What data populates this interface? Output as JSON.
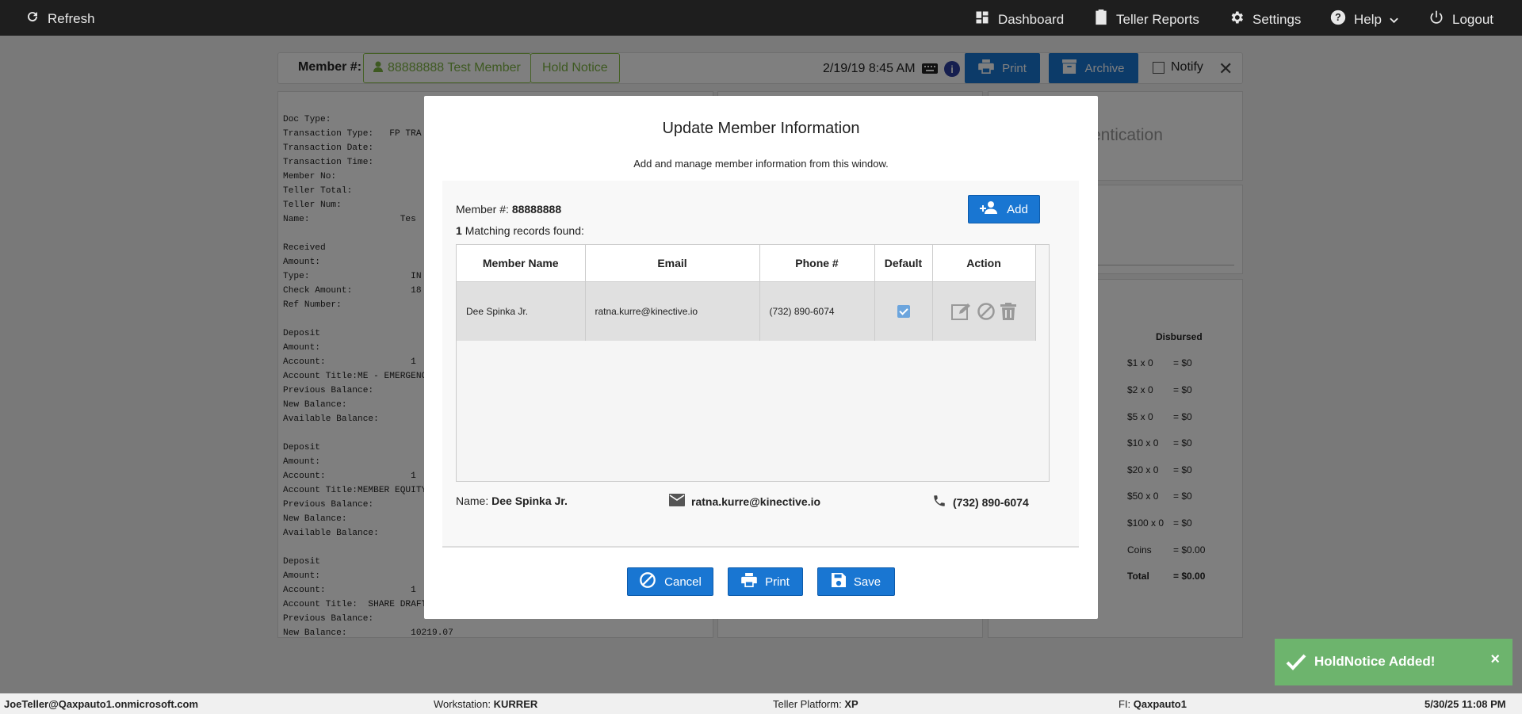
{
  "topbar": {
    "refresh": "Refresh",
    "dashboard": "Dashboard",
    "teller_reports": "Teller Reports",
    "settings": "Settings",
    "help": "Help",
    "logout": "Logout"
  },
  "member_bar": {
    "label": "Member #:",
    "member_chip": "88888888 Test Member",
    "hold_notice": "Hold Notice",
    "datetime": "2/19/19 8:45 AM",
    "info_icon": "i",
    "print": "Print",
    "archive": "Archive",
    "notify": "Notify",
    "close": "✕"
  },
  "receipt": {
    "text": "Doc Type:\nTransaction Type:   FP TRA\nTransaction Date:\nTransaction Time:\nMember No:\nTeller Total:\nTeller Num:\nName:                 Tes\n\nReceived\nAmount:\nType:                   IN\nCheck Amount:           18\nRef Number:\n\nDeposit\nAmount:\nAccount:                1\nAccount Title:ME - EMERGENC\nPrevious Balance:\nNew Balance:\nAvailable Balance:\n\nDeposit\nAmount:\nAccount:                1\nAccount Title:MEMBER EQUITY\nPrevious Balance:\nNew Balance:\nAvailable Balance:\n\nDeposit\nAmount:\nAccount:                1\nAccount Title:  SHARE DRAFT\nPrevious Balance:\nNew Balance:            10219.07"
  },
  "right_panels": {
    "auth_text": "entication",
    "disbursed_header": "Disbursed",
    "denominations": [
      {
        "label": "$1 x 0",
        "value": "= $0"
      },
      {
        "label": "$2 x 0",
        "value": "= $0"
      },
      {
        "label": "$5 x 0",
        "value": "= $0"
      },
      {
        "label": "$10 x 0",
        "value": "= $0"
      },
      {
        "label": "$20 x 0",
        "value": "= $0"
      },
      {
        "label": "$50 x 0",
        "value": "= $0"
      },
      {
        "label": "$100 x 0",
        "value": "= $0"
      },
      {
        "label": "Coins",
        "value": "= $0.00"
      }
    ],
    "total_label": "Total",
    "total_value": "= $0.00"
  },
  "modal": {
    "title": "Update Member Information",
    "subtitle": "Add and manage member information from this window.",
    "member_label": "Member #:",
    "member_number": "88888888",
    "matching_count": "1",
    "matching_text": "Matching records found:",
    "add_button": "Add",
    "table": {
      "headers": [
        "Member Name",
        "Email",
        "Phone #",
        "Default",
        "Action"
      ],
      "rows": [
        {
          "name": "Dee Spinka Jr.",
          "email": "ratna.kurre@kinective.io",
          "phone": "(732) 890-6074",
          "default": true
        }
      ]
    },
    "footer": {
      "name_label": "Name:",
      "name_value": "Dee Spinka Jr.",
      "email": "ratna.kurre@kinective.io",
      "phone": "(732) 890-6074"
    },
    "buttons": {
      "cancel": "Cancel",
      "print": "Print",
      "save": "Save"
    }
  },
  "toast": {
    "message": "HoldNotice Added!",
    "close": "×"
  },
  "statusbar": {
    "user": "JoeTeller@Qaxpauto1.onmicrosoft.com",
    "workstation_label": "Workstation:",
    "workstation": "KURRER",
    "platform_label": "Teller Platform:",
    "platform": "XP",
    "fi_label": "FI:",
    "fi": "Qaxpauto1",
    "datetime": "5/30/25 11:08 PM"
  },
  "colors": {
    "primary": "#1976d2",
    "success": "#6db46d",
    "member_green": "#7cb342",
    "topbar": "#1e1e1e"
  }
}
